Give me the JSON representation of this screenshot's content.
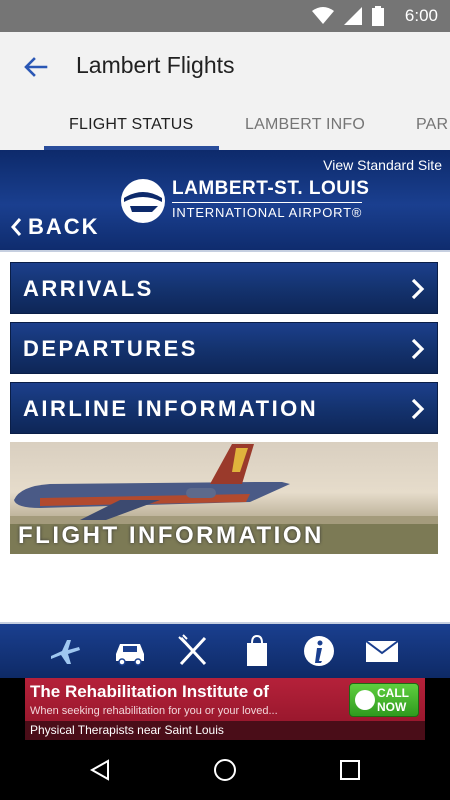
{
  "status_bar": {
    "time": "6:00"
  },
  "app_bar": {
    "title": "Lambert Flights"
  },
  "tabs": [
    {
      "label": "FLIGHT STATUS",
      "active": true
    },
    {
      "label": "LAMBERT INFO",
      "active": false
    },
    {
      "label": "PAR",
      "active": false
    }
  ],
  "web_header": {
    "view_standard_site": "View Standard Site",
    "logo_line1": "LAMBERT-ST. LOUIS",
    "logo_line2": "INTERNATIONAL AIRPORT®",
    "back_label": "BACK"
  },
  "menu": [
    {
      "label": "ARRIVALS"
    },
    {
      "label": "DEPARTURES"
    },
    {
      "label": "AIRLINE INFORMATION"
    }
  ],
  "banner": {
    "label": "FLIGHT INFORMATION"
  },
  "bottom_nav": {
    "icons": [
      "airplane-icon",
      "car-icon",
      "fork-knife-icon",
      "shopping-bag-icon",
      "info-icon",
      "mail-icon"
    ]
  },
  "ad": {
    "title": "The Rehabilitation Institute of",
    "subtitle": "When seeking rehabilitation for you or your loved...",
    "footer": "Physical Therapists near Saint Louis",
    "call_line1": "CALL",
    "call_line2": "NOW"
  },
  "colors": {
    "header_blue": "#0d2a6b",
    "tab_indicator": "#2a4d9b",
    "ad_red": "#b5213a",
    "call_green": "#3fb02a"
  }
}
